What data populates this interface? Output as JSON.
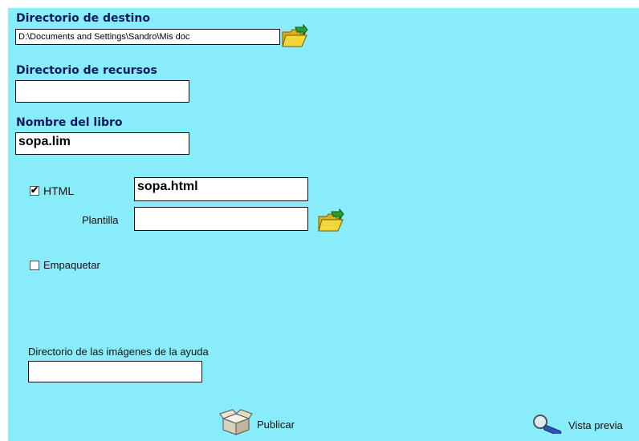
{
  "labels": {
    "destino": "Directorio de destino",
    "recursos": "Directorio de recursos",
    "nombre": "Nombre del libro",
    "html": "HTML",
    "plantilla": "Plantilla",
    "empaquetar": "Empaquetar",
    "ayuda": "Directorio de las imágenes de la ayuda"
  },
  "fields": {
    "destino_value": "D:\\Documents and Settings\\Sandro\\Mis doc",
    "recursos_value": "",
    "nombre_value": "sopa.lim",
    "html_value": "sopa.html",
    "plantilla_value": "",
    "ayuda_value": ""
  },
  "checkboxes": {
    "html_checked": true,
    "empaquetar_checked": false
  },
  "buttons": {
    "publicar": "Publicar",
    "vista_previa": "Vista previa"
  },
  "icons": [
    "folder-open-icon",
    "package-box-icon",
    "magnifier-icon"
  ],
  "colors": {
    "panel_background": "#88ecfb",
    "label_text": "#0b1a5c"
  }
}
